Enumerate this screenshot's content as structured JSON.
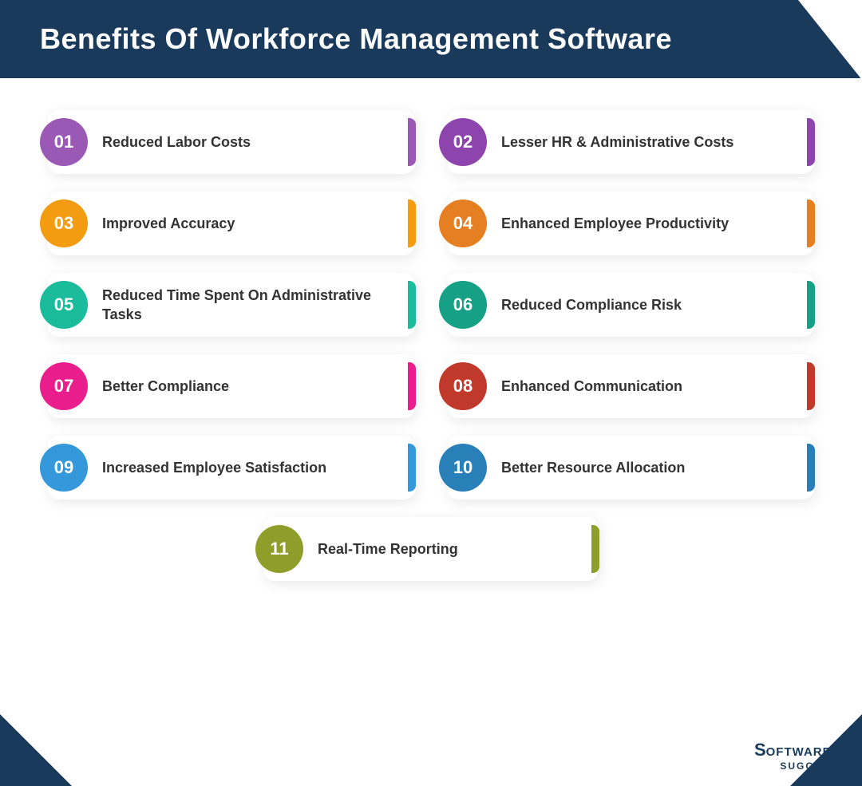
{
  "header": {
    "title": "Benefits Of Workforce Management Software"
  },
  "benefits": [
    {
      "number": "01",
      "text": "Reduced Labor Costs",
      "color": "#9b59b6",
      "accent": "#9b59b6"
    },
    {
      "number": "02",
      "text": "Lesser HR & Administrative Costs",
      "color": "#8e44ad",
      "accent": "#8e44ad"
    },
    {
      "number": "03",
      "text": "Improved Accuracy",
      "color": "#f39c12",
      "accent": "#f39c12"
    },
    {
      "number": "04",
      "text": "Enhanced Employee Productivity",
      "color": "#e67e22",
      "accent": "#e67e22"
    },
    {
      "number": "05",
      "text": "Reduced Time Spent On Administrative Tasks",
      "color": "#1abc9c",
      "accent": "#1abc9c"
    },
    {
      "number": "06",
      "text": "Reduced Compliance Risk",
      "color": "#16a085",
      "accent": "#16a085"
    },
    {
      "number": "07",
      "text": "Better Compliance",
      "color": "#e91e8c",
      "accent": "#e91e8c"
    },
    {
      "number": "08",
      "text": "Enhanced Communication",
      "color": "#c0392b",
      "accent": "#c0392b"
    },
    {
      "number": "09",
      "text": "Increased Employee Satisfaction",
      "color": "#3498db",
      "accent": "#3498db"
    },
    {
      "number": "10",
      "text": "Better Resource Allocation",
      "color": "#2980b9",
      "accent": "#2980b9"
    },
    {
      "number": "11",
      "text": "Real-Time Reporting",
      "color": "#8d9e2a",
      "accent": "#8d9e2a"
    }
  ],
  "logo": {
    "line1": "Software",
    "registered": "®",
    "line2": "Suggest"
  }
}
